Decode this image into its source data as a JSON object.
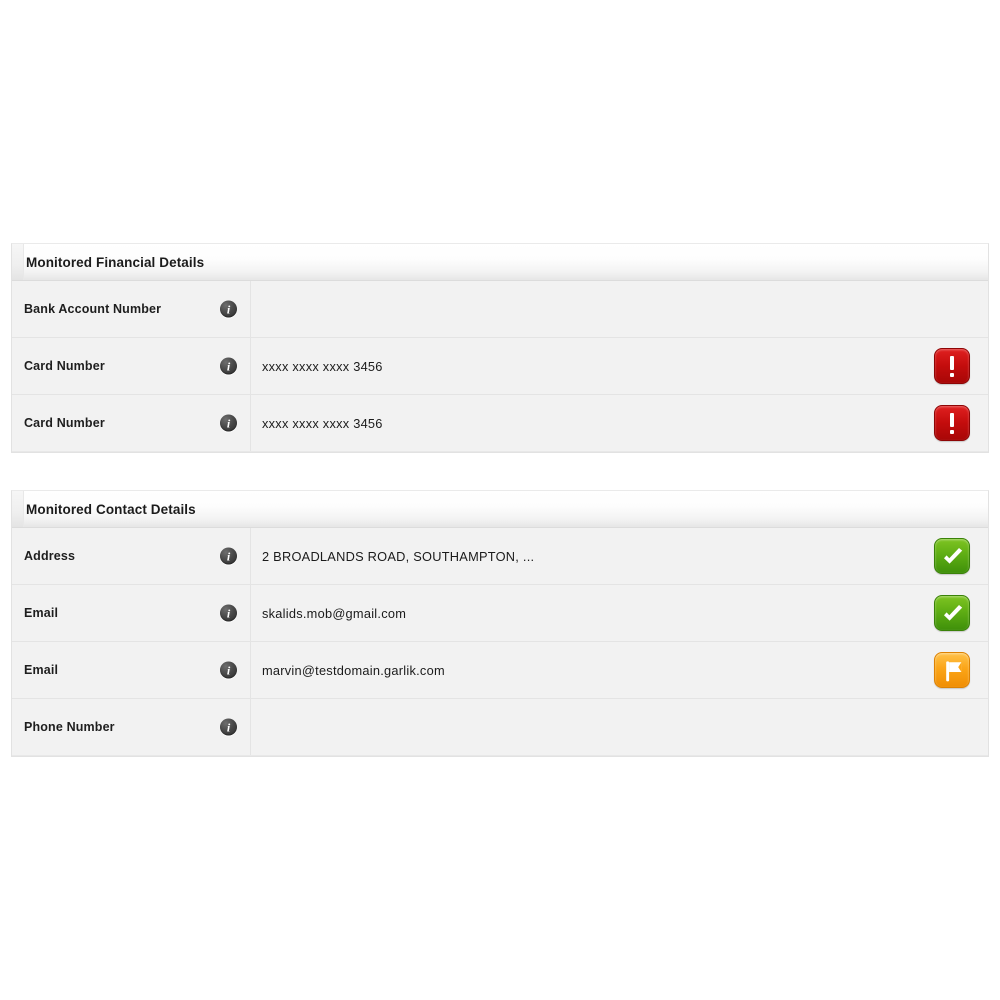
{
  "colors": {
    "page_background": "#ffffff",
    "panel_background": "#f2f2f2",
    "panel_border": "#e2e2e2",
    "row_divider": "#e4e4e4",
    "text": "#1b1b1b",
    "status_alert": "#c40d0d",
    "status_ok": "#5fae14",
    "status_flag": "#fba518",
    "info_icon": "#3a3a3a"
  },
  "icons": {
    "info": "info-circle-icon",
    "alert": "alert-exclamation-icon",
    "ok": "check-mark-icon",
    "flag": "flag-icon"
  },
  "panels": [
    {
      "title": "Monitored Financial Details",
      "rows": [
        {
          "label": "Bank Account Number",
          "value": "",
          "status": "none"
        },
        {
          "label": "Card Number",
          "value": "xxxx xxxx xxxx 3456",
          "status": "alert"
        },
        {
          "label": "Card Number",
          "value": "xxxx xxxx xxxx 3456",
          "status": "alert"
        }
      ]
    },
    {
      "title": "Monitored Contact Details",
      "rows": [
        {
          "label": "Address",
          "value": "2 BROADLANDS ROAD, SOUTHAMPTON, ...",
          "status": "ok"
        },
        {
          "label": "Email",
          "value": "skalids.mob@gmail.com",
          "status": "ok"
        },
        {
          "label": "Email",
          "value": "marvin@testdomain.garlik.com",
          "status": "flag"
        },
        {
          "label": "Phone Number",
          "value": "",
          "status": "none"
        }
      ]
    }
  ]
}
